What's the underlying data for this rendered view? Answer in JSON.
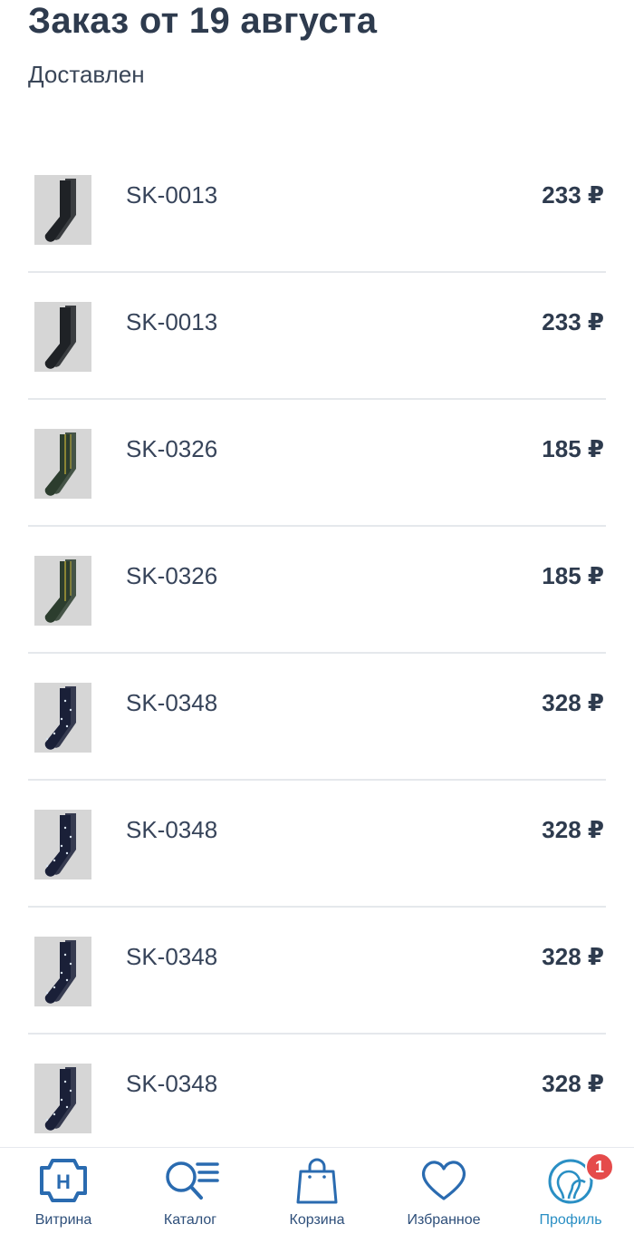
{
  "order": {
    "title": "Заказ от 19 августа",
    "status": "Доставлен"
  },
  "items": [
    {
      "sku": "SK-0013",
      "price": "233 ₽",
      "sock_color": "#1f2226",
      "pattern": "plain"
    },
    {
      "sku": "SK-0013",
      "price": "233 ₽",
      "sock_color": "#1f2226",
      "pattern": "plain"
    },
    {
      "sku": "SK-0326",
      "price": "185 ₽",
      "sock_color": "#2c3d2e",
      "pattern": "stripes"
    },
    {
      "sku": "SK-0326",
      "price": "185 ₽",
      "sock_color": "#2c3d2e",
      "pattern": "stripes"
    },
    {
      "sku": "SK-0348",
      "price": "328 ₽",
      "sock_color": "#1a2038",
      "pattern": "dots"
    },
    {
      "sku": "SK-0348",
      "price": "328 ₽",
      "sock_color": "#1a2038",
      "pattern": "dots"
    },
    {
      "sku": "SK-0348",
      "price": "328 ₽",
      "sock_color": "#1a2038",
      "pattern": "dots"
    },
    {
      "sku": "SK-0348",
      "price": "328 ₽",
      "sock_color": "#1a2038",
      "pattern": "dots"
    }
  ],
  "nav": {
    "showcase": {
      "label": "Витрина",
      "icon": "brand-logo-icon"
    },
    "catalog": {
      "label": "Каталог",
      "icon": "search-catalog-icon"
    },
    "cart": {
      "label": "Корзина",
      "icon": "shopping-bag-icon"
    },
    "favorites": {
      "label": "Избранное",
      "icon": "heart-icon"
    },
    "profile": {
      "label": "Профиль",
      "icon": "profile-icon",
      "badge": "1",
      "active": true
    }
  },
  "colors": {
    "text_dark": "#2e3b4e",
    "nav_text": "#2e4f7a",
    "nav_active": "#2a8fc4",
    "badge": "#e54b4b",
    "divider": "#e5e8ec"
  }
}
